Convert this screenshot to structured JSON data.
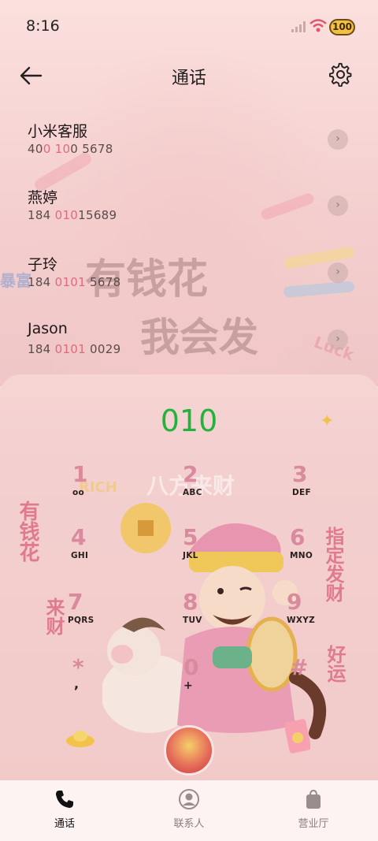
{
  "status_bar": {
    "time": "8:16",
    "battery": "100"
  },
  "header": {
    "title": "通话"
  },
  "contacts": [
    {
      "name": "小米客服",
      "number_parts": [
        "40",
        "0 10",
        "0 5678"
      ]
    },
    {
      "name": "燕婷",
      "number_parts": [
        "184 ",
        "010",
        "15689"
      ]
    },
    {
      "name": "子玲",
      "number_parts": [
        "184 ",
        "0101",
        " 5678"
      ]
    },
    {
      "name": "Jason",
      "number_parts": [
        "184 ",
        "0101",
        " 0029"
      ]
    }
  ],
  "dialer": {
    "dialed_number": "010",
    "keys": [
      {
        "digit": "1",
        "letters": "ᴏᴏ"
      },
      {
        "digit": "2",
        "letters": "ABC"
      },
      {
        "digit": "3",
        "letters": "DEF"
      },
      {
        "digit": "4",
        "letters": "GHI"
      },
      {
        "digit": "5",
        "letters": "JKL"
      },
      {
        "digit": "6",
        "letters": "MNO"
      },
      {
        "digit": "7",
        "letters": "PQRS"
      },
      {
        "digit": "8",
        "letters": "TUV"
      },
      {
        "digit": "9",
        "letters": "WXYZ"
      },
      {
        "digit": "*",
        "letters": ","
      },
      {
        "digit": "0",
        "letters": "+"
      },
      {
        "digit": "#",
        "letters": ""
      }
    ]
  },
  "wallpaper_text": {
    "line1": "有钱花",
    "line2": "我会发",
    "left_vertical": "有钱花",
    "right_vertical": "指定发财",
    "left_lower": "来财",
    "right_lower": "好运",
    "top_banner": "八方来财",
    "rich": "RICH",
    "luck": "Luck",
    "bao": "暴富"
  },
  "bottom_nav": [
    {
      "label": "通话",
      "active": true
    },
    {
      "label": "联系人",
      "active": false
    },
    {
      "label": "营业厅",
      "active": false
    }
  ],
  "colors": {
    "accent_green": "#23b33c",
    "highlight_pink": "#e06a7c",
    "background": "#f7d9d7"
  }
}
